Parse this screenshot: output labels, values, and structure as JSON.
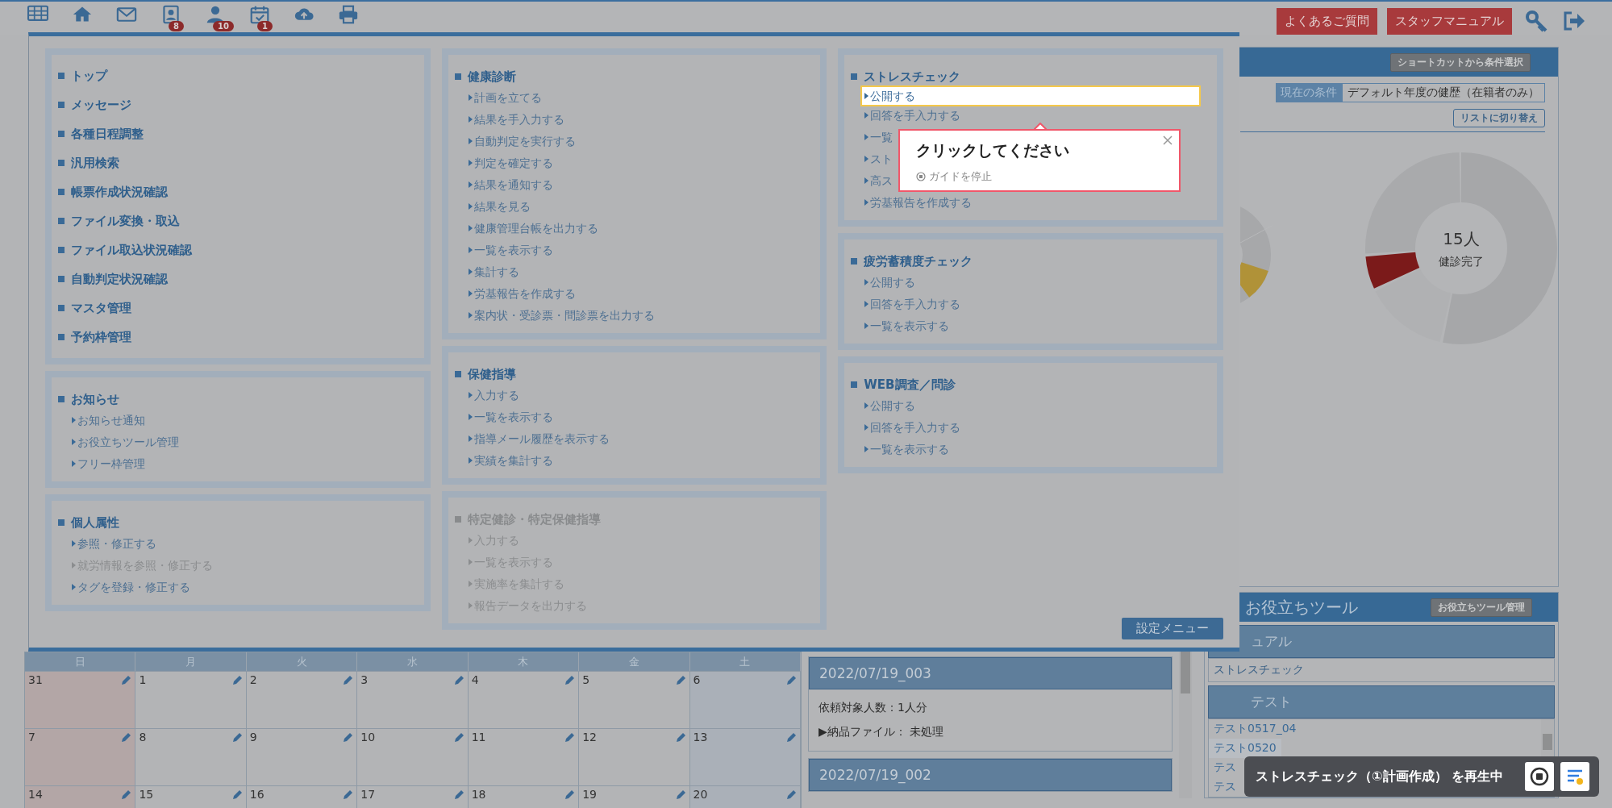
{
  "toolbar": {
    "icons": [
      {
        "kind": "grid"
      },
      {
        "kind": "home"
      },
      {
        "kind": "mail"
      },
      {
        "kind": "contacts",
        "badge": "8"
      },
      {
        "kind": "user",
        "badge": "10"
      },
      {
        "kind": "calendar",
        "badge": "1"
      },
      {
        "kind": "cloud"
      },
      {
        "kind": "print"
      }
    ],
    "buttons": [
      "よくあるご質問",
      "スタッフマニュアル"
    ],
    "right_icons": [
      {
        "kind": "key"
      },
      {
        "kind": "logout"
      }
    ]
  },
  "menu": {
    "columns": [
      [
        {
          "kind": "links",
          "items": [
            "トップ",
            "メッセージ",
            "各種日程調整",
            "汎用検索",
            "帳票作成状況確認",
            "ファイル変換・取込",
            "ファイル取込状況確認",
            "自動判定状況確認",
            "マスタ管理",
            "予約枠管理"
          ]
        },
        {
          "kind": "group",
          "title": "お知らせ",
          "disabled": false,
          "items": [
            {
              "label": "お知らせ通知",
              "disabled": false,
              "highlighted": false
            },
            {
              "label": "お役立ちツール管理",
              "disabled": false,
              "highlighted": false
            },
            {
              "label": "フリー枠管理",
              "disabled": false,
              "highlighted": false
            }
          ]
        },
        {
          "kind": "group",
          "title": "個人属性",
          "disabled": false,
          "items": [
            {
              "label": "参照・修正する",
              "disabled": false,
              "highlighted": false
            },
            {
              "label": "就労情報を参照・修正する",
              "disabled": true,
              "highlighted": false
            },
            {
              "label": "タグを登録・修正する",
              "disabled": false,
              "highlighted": false
            }
          ]
        }
      ],
      [
        {
          "kind": "group",
          "title": "健康診断",
          "disabled": false,
          "items": [
            {
              "label": "計画を立てる",
              "disabled": false,
              "highlighted": false
            },
            {
              "label": "結果を手入力する",
              "disabled": false,
              "highlighted": false
            },
            {
              "label": "自動判定を実行する",
              "disabled": false,
              "highlighted": false
            },
            {
              "label": "判定を確定する",
              "disabled": false,
              "highlighted": false
            },
            {
              "label": "結果を通知する",
              "disabled": false,
              "highlighted": false
            },
            {
              "label": "結果を見る",
              "disabled": false,
              "highlighted": false
            },
            {
              "label": "健康管理台帳を出力する",
              "disabled": false,
              "highlighted": false
            },
            {
              "label": "一覧を表示する",
              "disabled": false,
              "highlighted": false
            },
            {
              "label": "集計する",
              "disabled": false,
              "highlighted": false
            },
            {
              "label": "労基報告を作成する",
              "disabled": false,
              "highlighted": false
            },
            {
              "label": "案内状・受診票・問診票を出力する",
              "disabled": false,
              "highlighted": false
            }
          ]
        },
        {
          "kind": "group",
          "title": "保健指導",
          "disabled": false,
          "items": [
            {
              "label": "入力する",
              "disabled": false,
              "highlighted": false
            },
            {
              "label": "一覧を表示する",
              "disabled": false,
              "highlighted": false
            },
            {
              "label": "指導メール履歴を表示する",
              "disabled": false,
              "highlighted": false
            },
            {
              "label": "実績を集計する",
              "disabled": false,
              "highlighted": false
            }
          ]
        },
        {
          "kind": "group",
          "title": "特定健診・特定保健指導",
          "disabled": true,
          "items": [
            {
              "label": "入力する",
              "disabled": true,
              "highlighted": false
            },
            {
              "label": "一覧を表示する",
              "disabled": true,
              "highlighted": false
            },
            {
              "label": "実施率を集計する",
              "disabled": true,
              "highlighted": false
            },
            {
              "label": "報告データを出力する",
              "disabled": true,
              "highlighted": false
            }
          ]
        }
      ],
      [
        {
          "kind": "group",
          "title": "ストレスチェック",
          "disabled": false,
          "items": [
            {
              "label": "公開する",
              "disabled": false,
              "highlighted": true
            },
            {
              "label": "回答を手入力する",
              "disabled": false,
              "highlighted": false
            },
            {
              "label": "一覧",
              "disabled": false,
              "highlighted": false
            },
            {
              "label": "スト",
              "disabled": false,
              "highlighted": false
            },
            {
              "label": "高ス",
              "disabled": false,
              "highlighted": false
            },
            {
              "label": "労基報告を作成する",
              "disabled": false,
              "highlighted": false
            }
          ]
        },
        {
          "kind": "group",
          "title": "疲労蓄積度チェック",
          "disabled": false,
          "items": [
            {
              "label": "公開する",
              "disabled": false,
              "highlighted": false
            },
            {
              "label": "回答を手入力する",
              "disabled": false,
              "highlighted": false
            },
            {
              "label": "一覧を表示する",
              "disabled": false,
              "highlighted": false
            }
          ]
        },
        {
          "kind": "group",
          "title": "WEB調査／問診",
          "disabled": false,
          "items": [
            {
              "label": "公開する",
              "disabled": false,
              "highlighted": false
            },
            {
              "label": "回答を手入力する",
              "disabled": false,
              "highlighted": false
            },
            {
              "label": "一覧を表示する",
              "disabled": false,
              "highlighted": false
            }
          ]
        }
      ]
    ],
    "settings_button": "設定メニュー"
  },
  "guide_popup": {
    "title": "クリックしてください",
    "stop_label": "ガイドを停止"
  },
  "conditions": {
    "shortcut_button": "ショートカットから条件選択",
    "label": "現在の条件",
    "value": "デフォルト年度の健歴（在籍者のみ）",
    "switch_button": "リストに切り替え"
  },
  "donut": {
    "center_value": "15人",
    "center_label": "健診完了"
  },
  "calendar": {
    "weekdays": [
      "日",
      "月",
      "火",
      "水",
      "木",
      "金",
      "土"
    ],
    "weeks": [
      [
        "31",
        "1",
        "2",
        "3",
        "4",
        "5",
        "6"
      ],
      [
        "7",
        "8",
        "9",
        "10",
        "11",
        "12",
        "13"
      ],
      [
        "14",
        "15",
        "16",
        "17",
        "18",
        "19",
        "20"
      ]
    ]
  },
  "requests": [
    {
      "title": "2022/07/19_003",
      "lines": [
        "依頼対象人数：1人分",
        "▶納品ファイル： 未処理"
      ]
    },
    {
      "title": "2022/07/19_002"
    }
  ],
  "tools": {
    "title": "お役立ちツール",
    "manage_button": "お役立ちツール管理",
    "groups": [
      {
        "title": "ュアル",
        "items": [
          "ストレスチェック"
        ]
      },
      {
        "title": "テスト",
        "items": [
          "テスト0517_04",
          "テスト0520",
          "テス",
          "テス"
        ]
      }
    ]
  },
  "playback_toast": {
    "text": "ストレスチェック（①計画作成） を再生中"
  }
}
